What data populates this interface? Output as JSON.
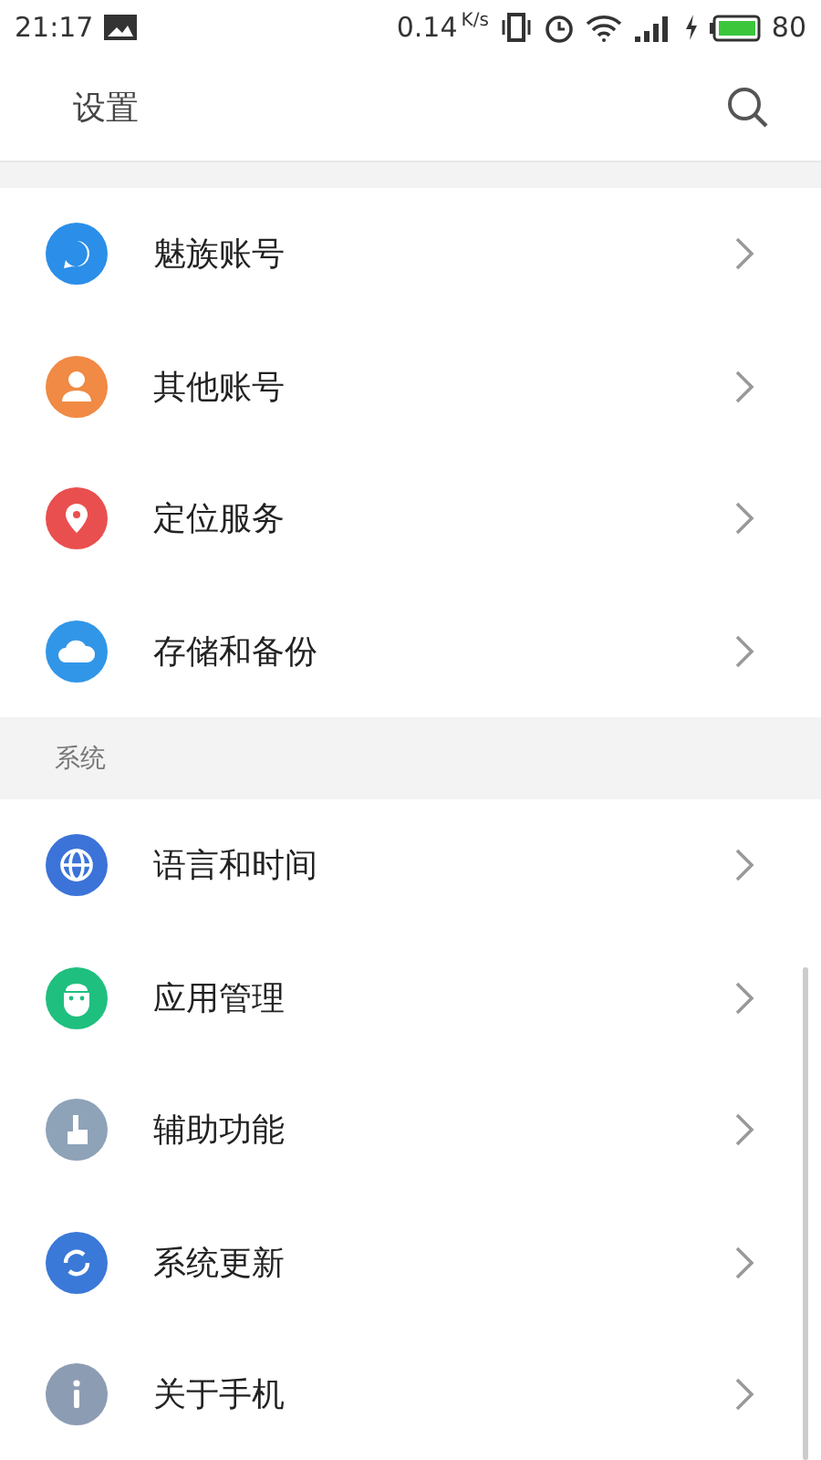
{
  "status_bar": {
    "time": "21:17",
    "speed": "0.14",
    "speed_unit": "K/s",
    "battery": "80"
  },
  "header": {
    "title": "设置"
  },
  "sections": [
    {
      "items": [
        {
          "label": "魅族账号",
          "kind": "account",
          "color": "#2b8ee8"
        },
        {
          "label": "其他账号",
          "kind": "person",
          "color": "#f08a44"
        },
        {
          "label": "定位服务",
          "kind": "location",
          "color": "#e94f4f"
        },
        {
          "label": "存储和备份",
          "kind": "cloud",
          "color": "#3196e8"
        }
      ]
    },
    {
      "title": "系统",
      "items": [
        {
          "label": "语言和时间",
          "kind": "globe",
          "color": "#3b73d8"
        },
        {
          "label": "应用管理",
          "kind": "android",
          "color": "#1fbf7f"
        },
        {
          "label": "辅助功能",
          "kind": "hand",
          "color": "#8ea2b8"
        },
        {
          "label": "系统更新",
          "kind": "sync",
          "color": "#3a79d8"
        },
        {
          "label": "关于手机",
          "kind": "info",
          "color": "#8c9db3"
        }
      ]
    }
  ]
}
